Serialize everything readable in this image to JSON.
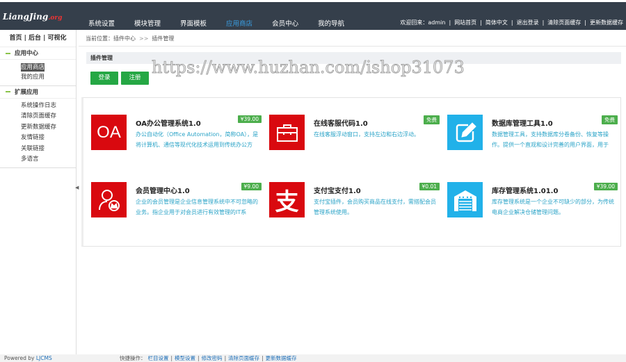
{
  "header": {
    "logo": "LiangJing",
    "logo_suffix": ".org",
    "nav": [
      "系统设置",
      "模块管理",
      "界面模板",
      "应用商店",
      "会员中心",
      "我的导航"
    ],
    "active_nav": 3,
    "welcome": "欢迎回来：admin",
    "links": [
      "网站首页",
      "简体中文",
      "退出登录",
      "清除页面缓存",
      "更新数据缓存"
    ]
  },
  "sidebar": {
    "top": "首页 | 后台 | 可视化",
    "groups": [
      {
        "title": "应用中心",
        "items": [
          "应用商店",
          "我的应用"
        ]
      },
      {
        "title": "扩展应用",
        "items": [
          "系统操作日志",
          "清除页面缓存",
          "更新数据缓存",
          "友情链接",
          "关联链接",
          "多语言"
        ]
      }
    ]
  },
  "breadcrumb": {
    "label": "当前位置：",
    "path": [
      "插件中心",
      "插件管理"
    ],
    "sep": ">>"
  },
  "panel": {
    "title": "插件管理",
    "login": "登录",
    "register": "注册"
  },
  "plugins": [
    {
      "title": "OA办公管理系统1.0",
      "price": "¥39.00",
      "desc": "办公自动化（Office Automation，简称OA），是将计算机、通信等现代化技术运用到传统办公方",
      "icon": "oa-icon",
      "color": "#d9090f"
    },
    {
      "title": "在线客服代码1.0",
      "price": "免费",
      "desc": "在线客服浮动窗口，支持左边和右边浮动。",
      "icon": "briefcase-icon",
      "color": "#d9090f"
    },
    {
      "title": "数据库管理工具1.0",
      "price": "免费",
      "desc": "数据管理工具，支持数据库分卷备份、恢复等操作。提供一个直观和设计完善的用户界面，用于",
      "icon": "edit-icon",
      "color": "#21b1e9"
    },
    {
      "title": "会员管理中心1.0",
      "price": "¥9.00",
      "desc": "企业的会员管理是企业信息管理系统中不可忽略的业务。指企业用于对会员进行有效管理的IT系",
      "icon": "user-crown-icon",
      "color": "#d9090f"
    },
    {
      "title": "支付宝支付1.0",
      "price": "¥0.01",
      "desc": "支付宝插件，会员购买商品在线支付，需搭配会员管理系统使用。",
      "icon": "alipay-icon",
      "color": "#d9090f"
    },
    {
      "title": "库存管理系统1.01.0",
      "price": "¥39.00",
      "desc": "库存管理系统是一个企业不可缺少的部分，为传统电商企业解决仓储管理问题。",
      "icon": "warehouse-icon",
      "color": "#21b1e9"
    }
  ],
  "watermark": "https://www.huzhan.com/ishop31073",
  "footer": {
    "powered": "Powered by ",
    "brand": "LJCMS",
    "quick_label": "快捷操作：",
    "quick": [
      "栏目设置",
      "模型设置",
      "修改密码",
      "清除页面缓存",
      "更新数据缓存"
    ]
  }
}
